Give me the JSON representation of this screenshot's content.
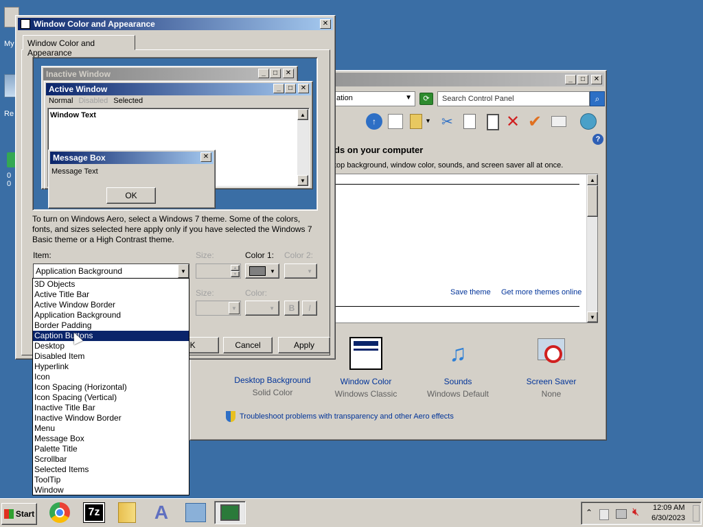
{
  "desktop": {
    "icon_labels": [
      "My",
      "Re",
      "0",
      "0"
    ]
  },
  "dialog": {
    "title": "Window Color and Appearance",
    "tab": "Window Color and Appearance",
    "preview": {
      "inactive_title": "Inactive Window",
      "active_title": "Active Window",
      "menu_normal": "Normal",
      "menu_disabled": "Disabled",
      "menu_selected": "Selected",
      "window_text": "Window Text",
      "msgbox_title": "Message Box",
      "msgbox_text": "Message Text",
      "msgbox_ok": "OK"
    },
    "info_text": "To turn on Windows Aero, select a Windows 7 theme.  Some of the colors, fonts, and sizes selected here apply only if you have selected the Windows 7 Basic theme or a High Contrast theme.",
    "item_label": "Item:",
    "item_value": "Application Background",
    "size_label": "Size:",
    "color1_label": "Color 1:",
    "color2_label": "Color 2:",
    "font_size_label": "Size:",
    "font_color_label": "Color:",
    "bold_label": "B",
    "italic_label": "I",
    "ok_label": "OK",
    "cancel_label": "Cancel",
    "apply_label": "Apply",
    "color1_swatch": "#808080",
    "item_options": [
      "3D Objects",
      "Active Title Bar",
      "Active Window Border",
      "Application Background",
      "Border Padding",
      "Caption Buttons",
      "Desktop",
      "Disabled Item",
      "Hyperlink",
      "Icon",
      "Icon Spacing (Horizontal)",
      "Icon Spacing (Vertical)",
      "Inactive Title Bar",
      "Inactive Window Border",
      "Menu",
      "Message Box",
      "Palette Title",
      "Scrollbar",
      "Selected Items",
      "ToolTip",
      "Window"
    ],
    "highlighted_option": "Caption Buttons"
  },
  "control_panel": {
    "address_partial": "ation",
    "search_placeholder": "Search Control Panel",
    "heading": "ds on your computer",
    "subtext": "top background, window color, sounds, and screen saver all at once.",
    "save_theme": "Save theme",
    "more_themes": "Get more themes online",
    "items": [
      {
        "label": "Desktop Background",
        "sub": "Solid Color"
      },
      {
        "label": "Window Color",
        "sub": "Windows Classic"
      },
      {
        "label": "Sounds",
        "sub": "Windows Default"
      },
      {
        "label": "Screen Saver",
        "sub": "None"
      }
    ],
    "troubleshoot": "Troubleshoot problems with transparency and other Aero effects"
  },
  "taskbar": {
    "start_label": "Start",
    "clock_time": "12:09 AM",
    "clock_date": "6/30/2023",
    "sevenzip_label": "7z"
  }
}
